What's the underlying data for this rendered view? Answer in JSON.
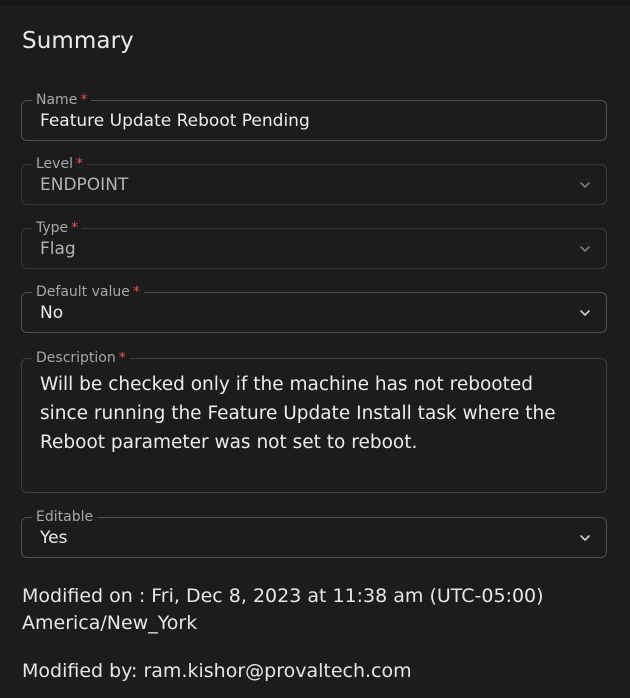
{
  "summary": {
    "title": "Summary"
  },
  "fields": {
    "name": {
      "label": "Name",
      "required_mark": "*",
      "value": "Feature Update Reboot Pending"
    },
    "level": {
      "label": "Level",
      "required_mark": "*",
      "value": "ENDPOINT",
      "icon": "chevron-down-icon"
    },
    "type": {
      "label": "Type",
      "required_mark": "*",
      "value": "Flag",
      "icon": "chevron-down-icon"
    },
    "default_value": {
      "label": "Default value",
      "required_mark": "*",
      "value": "No",
      "icon": "chevron-down-icon"
    },
    "description": {
      "label": "Description",
      "required_mark": "*",
      "value": "Will be checked only if the machine has not rebooted since running the Feature Update Install task where the Reboot parameter was not set to reboot."
    },
    "editable": {
      "label": "Editable",
      "value": "Yes",
      "icon": "chevron-down-icon"
    }
  },
  "meta": {
    "modified_on_line1": "Modified on : Fri, Dec 8, 2023 at 11:38 am (UTC-05:00)",
    "modified_on_line2": "America/New_York",
    "modified_by": "Modified by: ram.kishor@provaltech.com"
  },
  "colors": {
    "background": "#1c1c1c",
    "border": "#4f4f4f",
    "required": "#e35454",
    "label": "#a8a8a8",
    "text": "#ececec"
  }
}
